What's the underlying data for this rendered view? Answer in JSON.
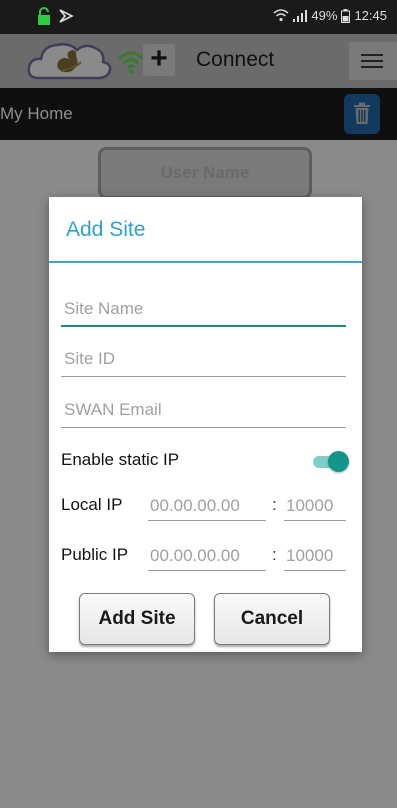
{
  "status_bar": {
    "battery": "49%",
    "time": "12:45"
  },
  "app_bar": {
    "title": "Connect"
  },
  "site_header": {
    "title": "My Home"
  },
  "background": {
    "user_name_label": "User Name"
  },
  "dialog": {
    "title": "Add Site",
    "fields": [
      {
        "placeholder": "Site Name"
      },
      {
        "placeholder": "Site ID"
      },
      {
        "placeholder": "SWAN Email"
      }
    ],
    "static_ip_label": "Enable static IP",
    "static_ip_enabled": true,
    "local_ip": {
      "label": "Local IP",
      "ip_placeholder": "00.00.00.00",
      "port_placeholder": "10000"
    },
    "public_ip": {
      "label": "Public IP",
      "ip_placeholder": "00.00.00.00",
      "port_placeholder": "10000"
    },
    "colon": ":",
    "add_button": "Add Site",
    "cancel_button": "Cancel"
  },
  "colors": {
    "accent": "#2f9fd4",
    "toggle": "#14958a",
    "trash": "#123a5e"
  }
}
